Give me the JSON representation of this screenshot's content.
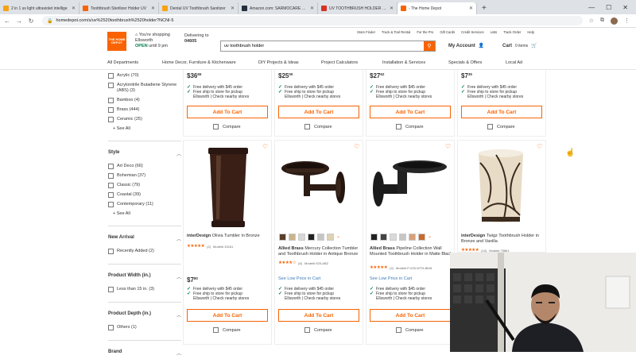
{
  "browser": {
    "tabs": [
      {
        "label": "2 in 1 uv light ultraviolet intellige",
        "color": "#f6a313"
      },
      {
        "label": "Toothbrush Sterilizer Holder UV",
        "color": "#f96302"
      },
      {
        "label": "Dental UV Toothbrush Sanitizer",
        "color": "#f6a313"
      },
      {
        "label": "Amazon.com: SARMOCARE Tooth",
        "color": "#232f3e"
      },
      {
        "label": "UV TOOTHBRUSH HOLDER | Cor",
        "color": "#d93025"
      },
      {
        "label": "- The Home Depot",
        "color": "#f96302"
      }
    ],
    "url": "homedepot.com/s/uv%2520toothbrush%2520holder?NCNI-5"
  },
  "header": {
    "logo_text": "THE HOME DEPOT",
    "store_line1": "You're shopping",
    "store_line2": "Ellsworth",
    "store_open": "OPEN",
    "store_hours": "until 9 pm",
    "delivering_label": "Delivering to",
    "zip": "04605",
    "search_value": "uv toothbrush holder",
    "top_links": [
      "Store Finder",
      "Truck & Tool Rental",
      "For the Pro",
      "Gift Cards",
      "Credit Services",
      "Lists",
      "Track Order",
      "Help"
    ],
    "account_label": "My Account",
    "cart_label": "Cart",
    "cart_count": "0 items",
    "nav": [
      "All Departments",
      "Home Decor, Furniture & Kitchenware",
      "DIY Projects & Ideas",
      "Project Calculators",
      "Installation & Services",
      "Specials & Offers",
      "Local Ad"
    ]
  },
  "sidebar": {
    "material_items": [
      "Acrylic (70)",
      "Acrylonitrile Butadiene Styrene (ABS) (3)",
      "Bamboo (4)",
      "Brass (444)",
      "Ceramic (25)"
    ],
    "see_all": "+ See All",
    "style_title": "Style",
    "style_items": [
      "Art Deco (66)",
      "Bohemian (37)",
      "Classic (79)",
      "Coastal (39)",
      "Contemporary (11)"
    ],
    "new_arrival_title": "New Arrival",
    "new_arrival_items": [
      "Recently Added (2)"
    ],
    "width_title": "Product Width (in.)",
    "width_items": [
      "Less than 15 in. (3)"
    ],
    "depth_title": "Product Depth (in.)",
    "depth_items": [
      "Others (1)"
    ],
    "brand_title": "Brand"
  },
  "top_row": [
    {
      "dollars": "$36",
      "cents": "65"
    },
    {
      "dollars": "$25",
      "cents": "00"
    },
    {
      "dollars": "$27",
      "cents": "62"
    },
    {
      "dollars": "$7",
      "cents": "35"
    }
  ],
  "common": {
    "free_delivery": "Free delivery with $45 order",
    "free_ship": "Free ship to store for pickup",
    "store_link": "Ellsworth | Check nearby stores",
    "add_to_cart": "Add To Cart",
    "compare": "Compare",
    "see_low": "See Low Price in Cart"
  },
  "products": [
    {
      "brand": "interDesign",
      "name": "Olivia Tumbler in Bronze",
      "stars": "★★★★★",
      "reviews": "(2)",
      "model": "Model# 33161",
      "dollars": "$7",
      "cents": "80"
    },
    {
      "brand": "Allied Brass",
      "name": "Mercury Collection Tumbler and Toothbrush Holder in Antique Bronze",
      "stars": "★★★★☆",
      "reviews": "(6)",
      "model": "Model# 925-ABZ",
      "price_text": "See Low Price in Cart"
    },
    {
      "brand": "Allied Brass",
      "name": "Pipeline Collection Wall Mounted Toothbrush Holder in Matte Black",
      "stars": "★★★★★",
      "reviews": "(2)",
      "model": "Model# P-020-WTH-BKM",
      "price_text": "See Low Price in Cart"
    },
    {
      "brand": "interDesign",
      "name": "Twigz Toothbrush Holder in Bronze and Vanilla",
      "stars": "★★★★★",
      "reviews": "(10)",
      "model": "Model# 75861"
    }
  ],
  "colors": {
    "brand": "#f96302",
    "success": "#00804a",
    "link": "#3e7ab8"
  }
}
